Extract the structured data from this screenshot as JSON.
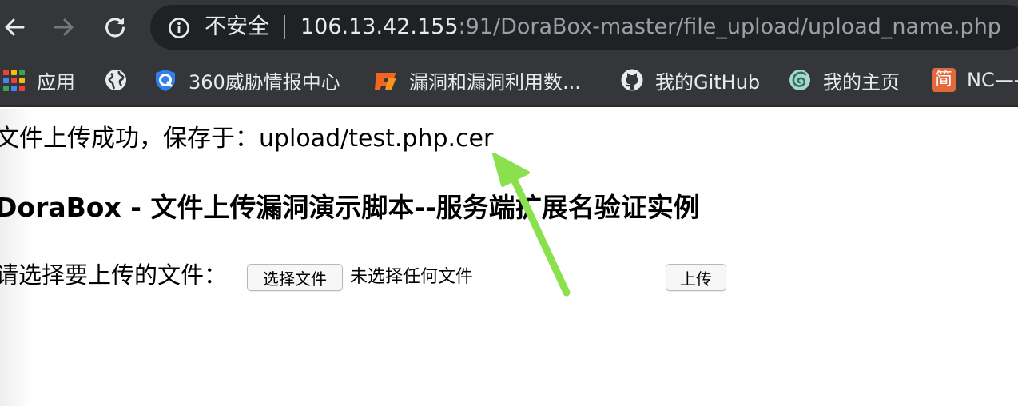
{
  "browser": {
    "security_label": "不安全",
    "url_host": "106.13.42.155",
    "url_rest": ":91/DoraBox-master/file_upload/upload_name.php",
    "bookmarks": [
      {
        "label": "应用",
        "icon": "apps-icon"
      },
      {
        "label": "360威胁情报中心",
        "icon": "360-threat-shield-icon"
      },
      {
        "label": "漏洞和漏洞利用数...",
        "icon": "exploit-db-icon"
      },
      {
        "label": "我的GitHub",
        "icon": "github-icon"
      },
      {
        "label": "我的主页",
        "icon": "homepage-swirl-icon"
      },
      {
        "label": "NC——",
        "icon": "jian-shu-icon"
      }
    ],
    "jian_char": "简"
  },
  "page": {
    "upload_result": "文件上传成功，保存于：upload/test.php.cer",
    "heading": "DoraBox - 文件上传漏洞演示脚本--服务端扩展名验证实例",
    "form": {
      "label": "请选择要上传的文件：",
      "choose_button": "选择文件",
      "no_file_text": "未选择任何文件",
      "submit_button": "上传"
    }
  },
  "colors": {
    "toolbar_bg": "#35363a",
    "omnibox_bg": "#202124",
    "annotation_arrow": "#8be04e"
  }
}
